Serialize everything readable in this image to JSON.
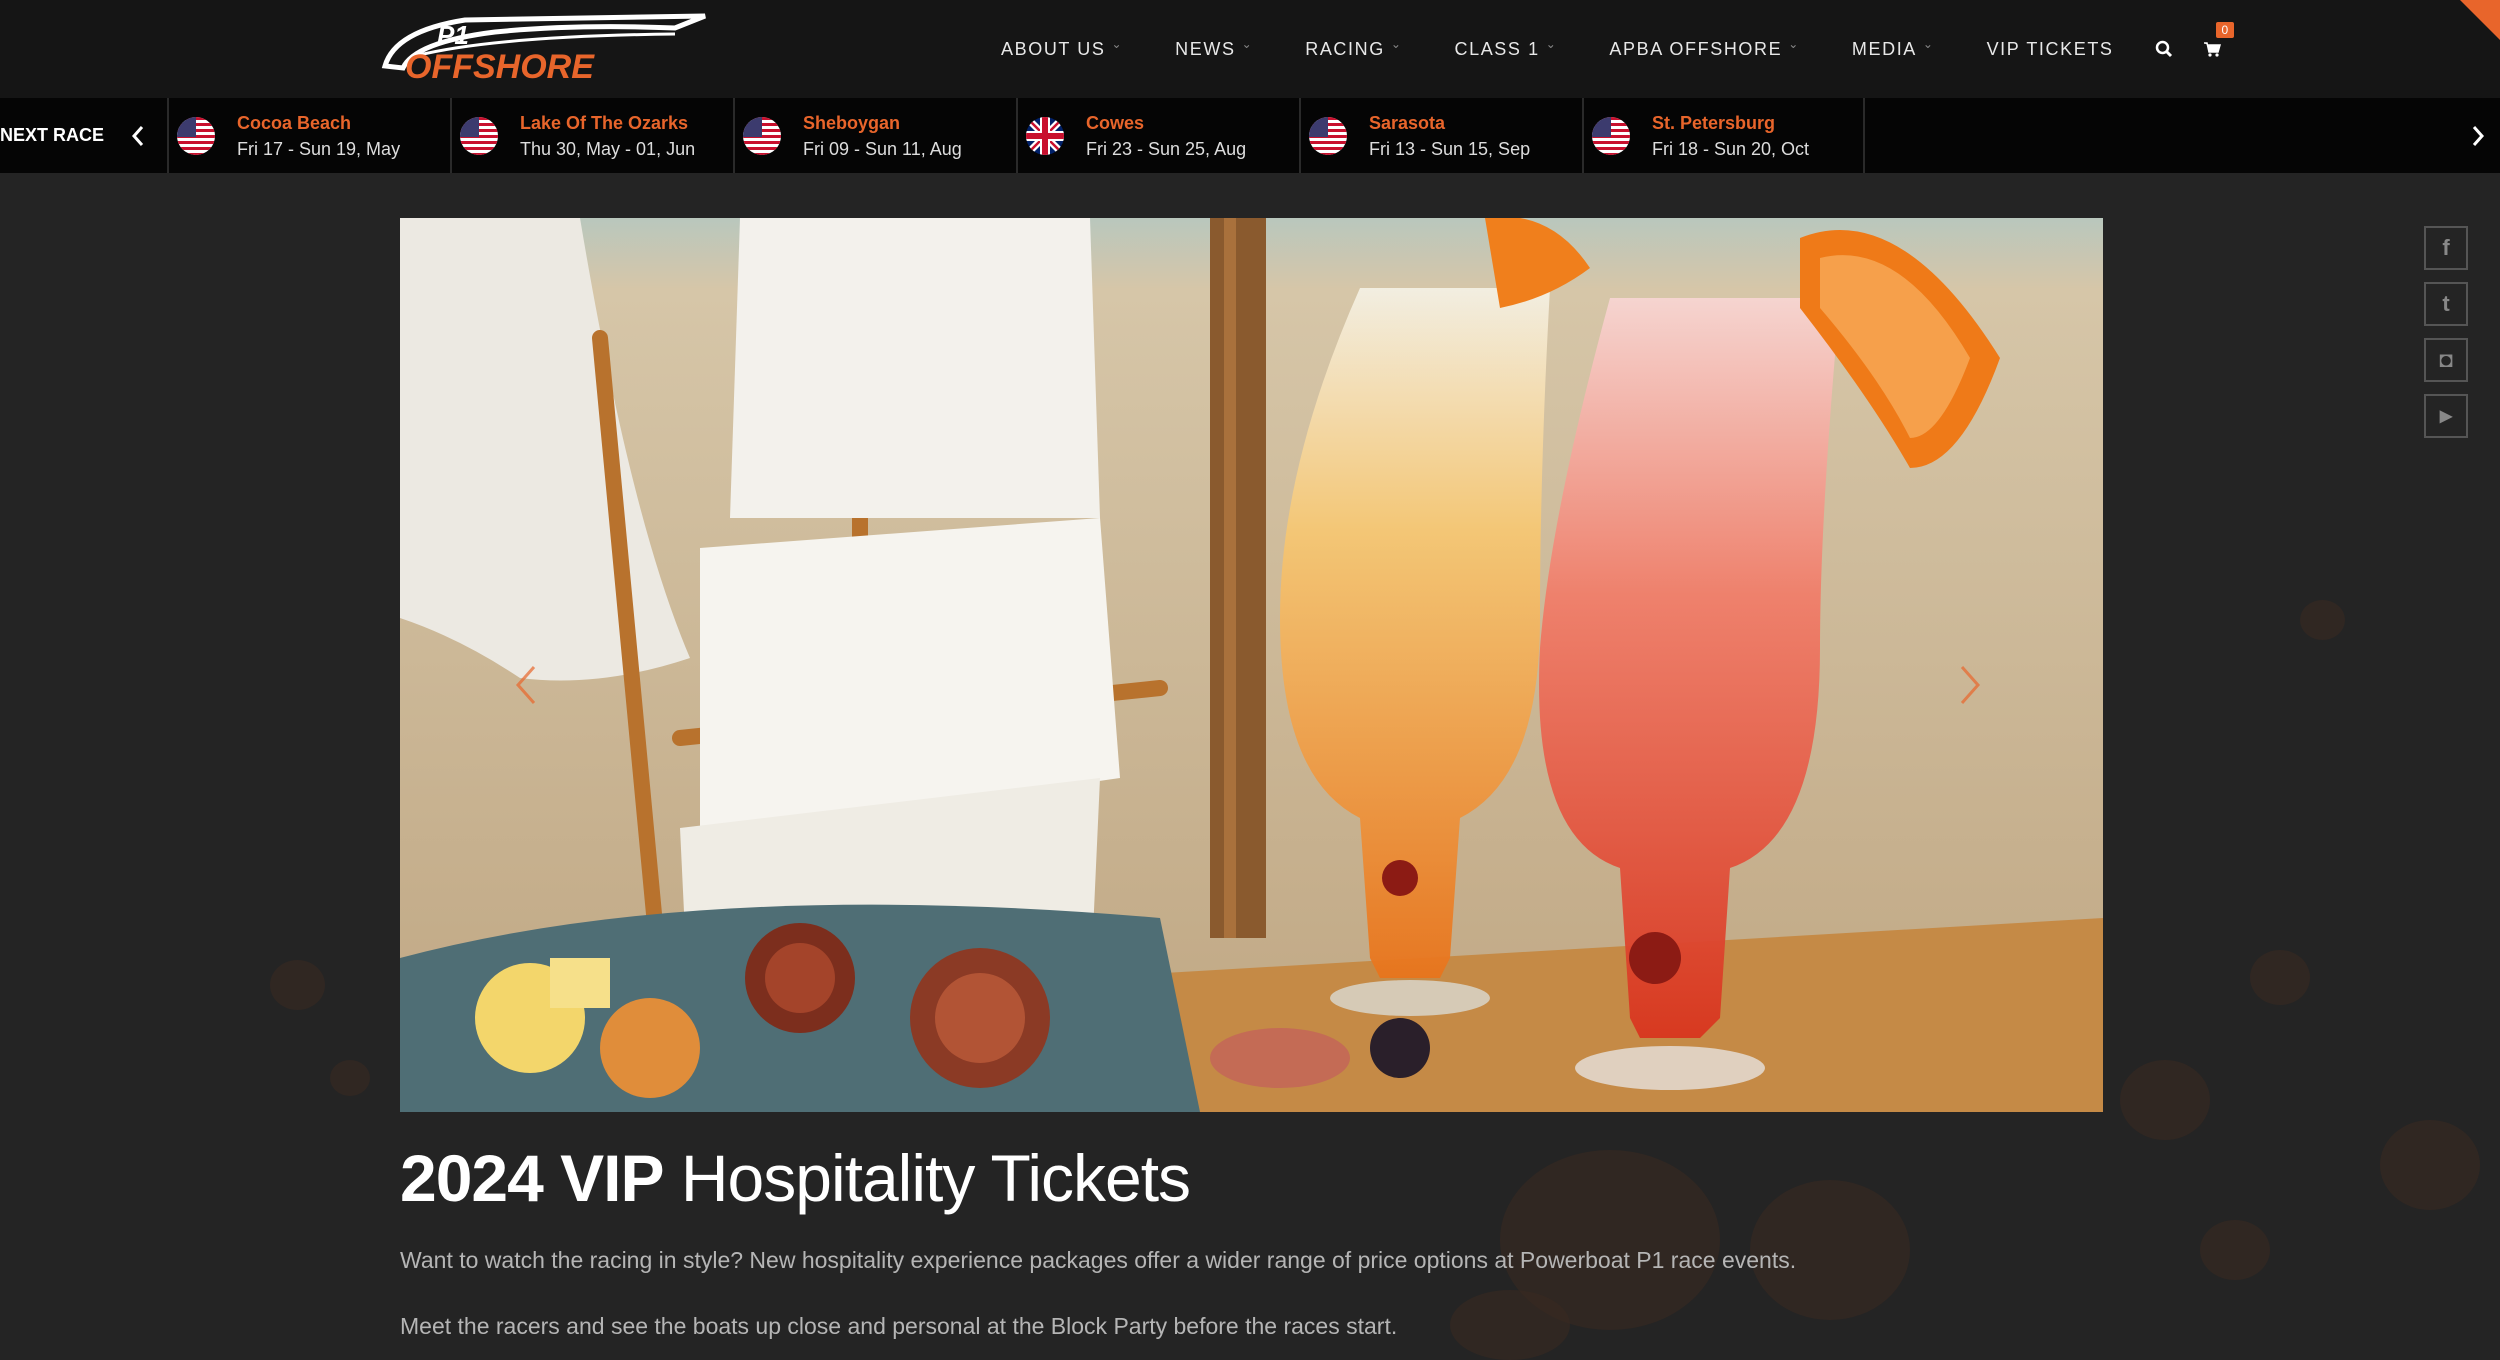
{
  "header": {
    "logo_mark": "P1",
    "logo_text": "OFFSHORE",
    "nav": [
      {
        "label": "ABOUT US",
        "has_dropdown": true
      },
      {
        "label": "NEWS",
        "has_dropdown": true
      },
      {
        "label": "RACING",
        "has_dropdown": true
      },
      {
        "label": "CLASS 1",
        "has_dropdown": true
      },
      {
        "label": "APBA OFFSHORE",
        "has_dropdown": true
      },
      {
        "label": "MEDIA",
        "has_dropdown": true
      },
      {
        "label": "VIP TICKETS",
        "has_dropdown": false
      }
    ],
    "search_icon": "search-icon",
    "cart_icon": "cart-icon",
    "cart_count": "0",
    "accent": "#e8652b"
  },
  "racebar": {
    "label": "NEXT RACE",
    "races": [
      {
        "name": "Cocoa Beach",
        "date": "Fri 17 - Sun 19, May",
        "flag": "us"
      },
      {
        "name": "Lake Of The Ozarks",
        "date": "Thu 30, May - 01, Jun",
        "flag": "us"
      },
      {
        "name": "Sheboygan",
        "date": "Fri 09 - Sun 11, Aug",
        "flag": "us"
      },
      {
        "name": "Cowes",
        "date": "Fri 23 - Sun 25, Aug",
        "flag": "uk"
      },
      {
        "name": "Sarasota",
        "date": "Fri 13 - Sun 15, Sep",
        "flag": "us"
      },
      {
        "name": "St. Petersburg",
        "date": "Fri 18 - Sun 20, Oct",
        "flag": "us"
      }
    ]
  },
  "social": [
    {
      "icon": "facebook-icon",
      "glyph": "f"
    },
    {
      "icon": "twitter-icon",
      "glyph": "t"
    },
    {
      "icon": "instagram-icon",
      "glyph": "◘"
    },
    {
      "icon": "youtube-icon",
      "glyph": "▶"
    }
  ],
  "main": {
    "title_bold": "2024 VIP",
    "title_rest": " Hospitality Tickets",
    "paragraphs": [
      "Want to watch the racing in style? New hospitality experience packages offer a wider range of price options at Powerboat P1 race events.",
      "Meet the racers and see the boats up close and personal at the Block Party before the races start."
    ]
  }
}
